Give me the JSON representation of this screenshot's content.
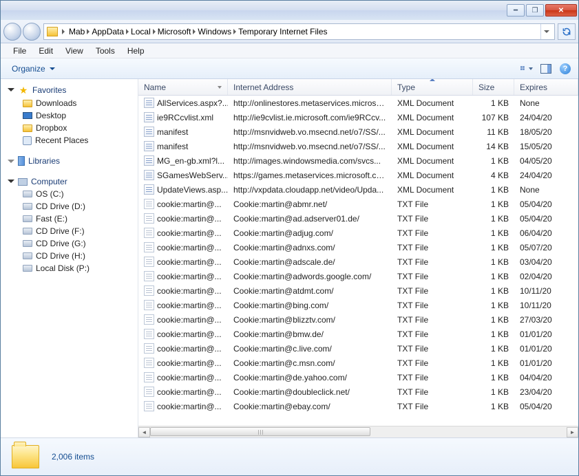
{
  "window_controls": {
    "min": "━",
    "max": "❐",
    "close": "✕"
  },
  "breadcrumb": [
    "Mab",
    "AppData",
    "Local",
    "Microsoft",
    "Windows",
    "Temporary Internet Files"
  ],
  "menu": [
    "File",
    "Edit",
    "View",
    "Tools",
    "Help"
  ],
  "toolbar": {
    "organize": "Organize"
  },
  "nav": {
    "favorites": {
      "label": "Favorites",
      "items": [
        "Downloads",
        "Desktop",
        "Dropbox",
        "Recent Places"
      ]
    },
    "libraries": {
      "label": "Libraries"
    },
    "computer": {
      "label": "Computer",
      "drives": [
        "OS (C:)",
        "CD Drive (D:)",
        "Fast (E:)",
        "CD Drive (F:)",
        "CD Drive (G:)",
        "CD Drive (H:)",
        "Local Disk (P:)"
      ]
    }
  },
  "columns": {
    "name": "Name",
    "addr": "Internet Address",
    "type": "Type",
    "size": "Size",
    "expires": "Expires"
  },
  "files": [
    {
      "name": "AllServices.aspx?...",
      "addr": "http://onlinestores.metaservices.microso...",
      "type": "XML Document",
      "size": "1 KB",
      "expires": "None",
      "icon": "xml"
    },
    {
      "name": "ie9RCcvlist.xml",
      "addr": "http://ie9cvlist.ie.microsoft.com/ie9RCcv...",
      "type": "XML Document",
      "size": "107 KB",
      "expires": "24/04/20",
      "icon": "xml"
    },
    {
      "name": "manifest",
      "addr": "http://msnvidweb.vo.msecnd.net/o7/SS/...",
      "type": "XML Document",
      "size": "11 KB",
      "expires": "18/05/20",
      "icon": "xml"
    },
    {
      "name": "manifest",
      "addr": "http://msnvidweb.vo.msecnd.net/o7/SS/...",
      "type": "XML Document",
      "size": "14 KB",
      "expires": "15/05/20",
      "icon": "xml"
    },
    {
      "name": "MG_en-gb.xml?l...",
      "addr": "http://images.windowsmedia.com/svcs...",
      "type": "XML Document",
      "size": "1 KB",
      "expires": "04/05/20",
      "icon": "xml"
    },
    {
      "name": "SGamesWebServ...",
      "addr": "https://games.metaservices.microsoft.co...",
      "type": "XML Document",
      "size": "4 KB",
      "expires": "24/04/20",
      "icon": "xml"
    },
    {
      "name": "UpdateViews.asp...",
      "addr": "http://vxpdata.cloudapp.net/video/Upda...",
      "type": "XML Document",
      "size": "1 KB",
      "expires": "None",
      "icon": "xml"
    },
    {
      "name": "cookie:martin@...",
      "addr": "Cookie:martin@abmr.net/",
      "type": "TXT File",
      "size": "1 KB",
      "expires": "05/04/20",
      "icon": "txt"
    },
    {
      "name": "cookie:martin@...",
      "addr": "Cookie:martin@ad.adserver01.de/",
      "type": "TXT File",
      "size": "1 KB",
      "expires": "05/04/20",
      "icon": "txt"
    },
    {
      "name": "cookie:martin@...",
      "addr": "Cookie:martin@adjug.com/",
      "type": "TXT File",
      "size": "1 KB",
      "expires": "06/04/20",
      "icon": "txt"
    },
    {
      "name": "cookie:martin@...",
      "addr": "Cookie:martin@adnxs.com/",
      "type": "TXT File",
      "size": "1 KB",
      "expires": "05/07/20",
      "icon": "txt"
    },
    {
      "name": "cookie:martin@...",
      "addr": "Cookie:martin@adscale.de/",
      "type": "TXT File",
      "size": "1 KB",
      "expires": "03/04/20",
      "icon": "txt"
    },
    {
      "name": "cookie:martin@...",
      "addr": "Cookie:martin@adwords.google.com/",
      "type": "TXT File",
      "size": "1 KB",
      "expires": "02/04/20",
      "icon": "txt"
    },
    {
      "name": "cookie:martin@...",
      "addr": "Cookie:martin@atdmt.com/",
      "type": "TXT File",
      "size": "1 KB",
      "expires": "10/11/20",
      "icon": "txt"
    },
    {
      "name": "cookie:martin@...",
      "addr": "Cookie:martin@bing.com/",
      "type": "TXT File",
      "size": "1 KB",
      "expires": "10/11/20",
      "icon": "txt"
    },
    {
      "name": "cookie:martin@...",
      "addr": "Cookie:martin@blizztv.com/",
      "type": "TXT File",
      "size": "1 KB",
      "expires": "27/03/20",
      "icon": "txt"
    },
    {
      "name": "cookie:martin@...",
      "addr": "Cookie:martin@bmw.de/",
      "type": "TXT File",
      "size": "1 KB",
      "expires": "01/01/20",
      "icon": "txt"
    },
    {
      "name": "cookie:martin@...",
      "addr": "Cookie:martin@c.live.com/",
      "type": "TXT File",
      "size": "1 KB",
      "expires": "01/01/20",
      "icon": "txt"
    },
    {
      "name": "cookie:martin@...",
      "addr": "Cookie:martin@c.msn.com/",
      "type": "TXT File",
      "size": "1 KB",
      "expires": "01/01/20",
      "icon": "txt"
    },
    {
      "name": "cookie:martin@...",
      "addr": "Cookie:martin@de.yahoo.com/",
      "type": "TXT File",
      "size": "1 KB",
      "expires": "04/04/20",
      "icon": "txt"
    },
    {
      "name": "cookie:martin@...",
      "addr": "Cookie:martin@doubleclick.net/",
      "type": "TXT File",
      "size": "1 KB",
      "expires": "23/04/20",
      "icon": "txt"
    },
    {
      "name": "cookie:martin@...",
      "addr": "Cookie:martin@ebay.com/",
      "type": "TXT File",
      "size": "1 KB",
      "expires": "05/04/20",
      "icon": "txt"
    }
  ],
  "status": {
    "count_label": "2,006 items"
  }
}
